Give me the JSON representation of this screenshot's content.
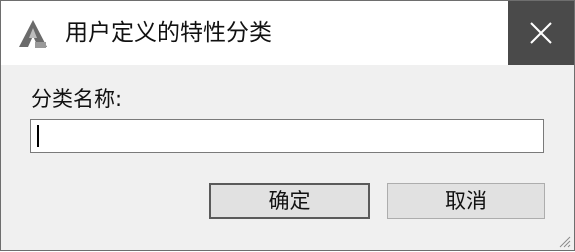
{
  "window": {
    "title": "用户定义的特性分类",
    "app_icon": "autocad-icon",
    "close_icon": "close-icon"
  },
  "form": {
    "label": "分类名称:",
    "input_value": "",
    "input_placeholder": ""
  },
  "buttons": {
    "ok_label": "确定",
    "cancel_label": "取消"
  },
  "colors": {
    "close_bg": "#4a4a4a",
    "dialog_bg": "#f0f0f0",
    "titlebar_bg": "#ffffff"
  }
}
